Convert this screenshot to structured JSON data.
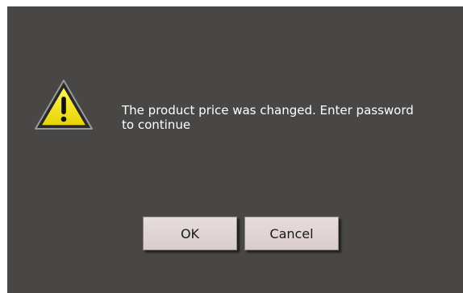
{
  "dialog": {
    "icon": "warning-icon",
    "message": "The product price was changed. Enter password\nto continue",
    "ok_label": "OK",
    "cancel_label": "Cancel"
  },
  "colors": {
    "background": "#484746",
    "text": "#ffffff",
    "button": "#e2d7d7",
    "warning_fill": "#f5e400"
  }
}
